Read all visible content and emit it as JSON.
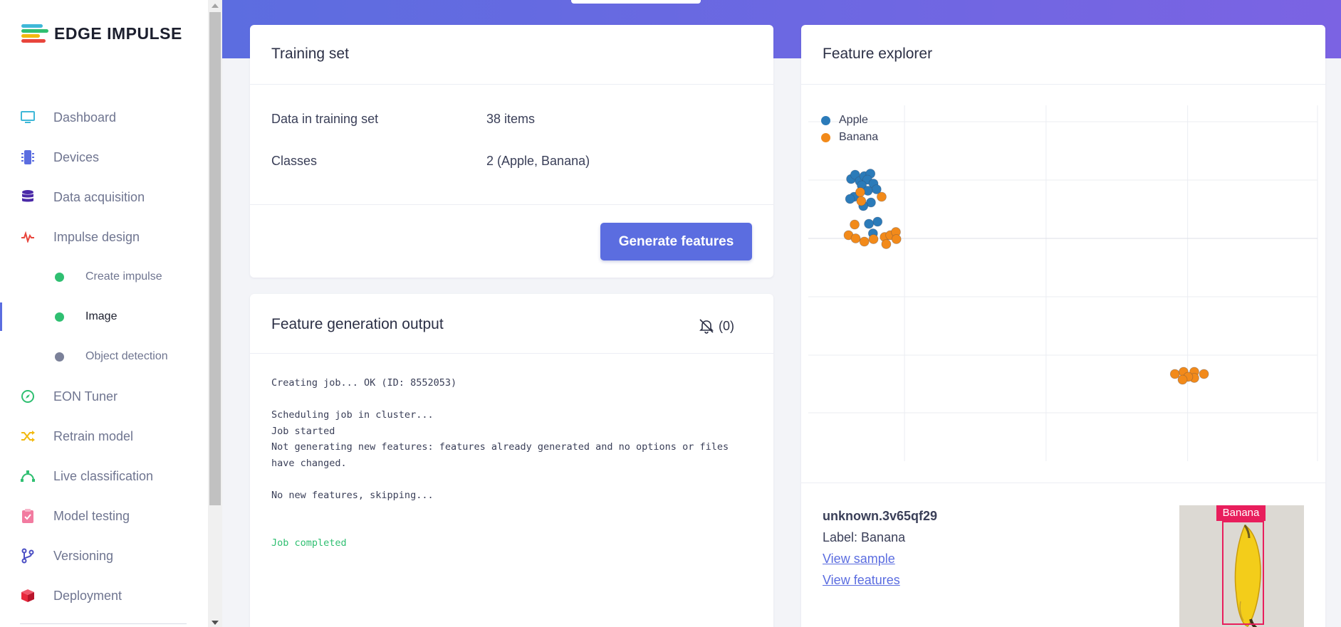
{
  "brand": {
    "name": "EDGE IMPULSE"
  },
  "nav": {
    "items": [
      {
        "label": "Dashboard",
        "icon": "monitor-icon",
        "color": "#3fb8d8"
      },
      {
        "label": "Devices",
        "icon": "chip-icon",
        "color": "#5b6de0"
      },
      {
        "label": "Data acquisition",
        "icon": "database-icon",
        "color": "#4b2aa8"
      },
      {
        "label": "Impulse design",
        "icon": "pulse-icon",
        "color": "#e8453c"
      }
    ],
    "sub_items": [
      {
        "label": "Create impulse",
        "dot_color": "#2fbf71"
      },
      {
        "label": "Image",
        "dot_color": "#2fbf71"
      },
      {
        "label": "Object detection",
        "dot_color": "#7b8199"
      }
    ],
    "bottom_items": [
      {
        "label": "EON Tuner",
        "icon": "compass-icon",
        "color": "#2fbf71"
      },
      {
        "label": "Retrain model",
        "icon": "shuffle-icon",
        "color": "#f2b90f"
      },
      {
        "label": "Live classification",
        "icon": "bezier-icon",
        "color": "#2fbf71"
      },
      {
        "label": "Model testing",
        "icon": "clipboard-check-icon",
        "color": "#f27ba0"
      },
      {
        "label": "Versioning",
        "icon": "branch-icon",
        "color": "#4b4fc4"
      },
      {
        "label": "Deployment",
        "icon": "cube-icon",
        "color": "#e8283c"
      }
    ]
  },
  "training_set": {
    "title": "Training set",
    "rows": [
      {
        "label": "Data in training set",
        "value": "38 items"
      },
      {
        "label": "Classes",
        "value": "2 (Apple, Banana)"
      }
    ],
    "button": "Generate features"
  },
  "feature_output": {
    "title": "Feature generation output",
    "notification_count": "(0)",
    "log": [
      "Creating job... OK (ID: 8552053)",
      "",
      "Scheduling job in cluster...",
      "Job started",
      "Not generating new features: features already generated and no options or files",
      "have changed.",
      "",
      "No new features, skipping...",
      "",
      ""
    ],
    "log_done": "Job completed"
  },
  "feature_explorer": {
    "title": "Feature explorer",
    "legend": [
      {
        "name": "Apple",
        "color": "#2b7bb9"
      },
      {
        "name": "Banana",
        "color": "#f28a1a"
      }
    ],
    "sample": {
      "id": "unknown.3v65qf29",
      "label": "Label: Banana",
      "view_sample": "View sample",
      "view_features": "View features",
      "bbox_label": "Banana"
    }
  },
  "chart_data": {
    "type": "scatter",
    "title": "",
    "xlabel": "",
    "ylabel": "",
    "grid": true,
    "legend": "top-left",
    "xlim": [
      0,
      100
    ],
    "ylim": [
      0,
      100
    ],
    "series": [
      {
        "name": "Apple",
        "color": "#2b7bb9",
        "x": [
          8.4,
          9.2,
          10.1,
          11.0,
          12.2,
          11.6,
          10.5,
          12.8,
          9.0,
          13.4,
          11.7,
          8.2,
          12.3,
          10.8,
          13.6,
          11.9,
          12.7
        ],
        "y": [
          79.3,
          80.5,
          78.7,
          80.1,
          80.8,
          79.1,
          77.5,
          78.0,
          74.3,
          76.4,
          76.0,
          73.7,
          72.7,
          71.7,
          67.3,
          66.7,
          64.0
        ]
      },
      {
        "name": "Banana",
        "color": "#f28a1a",
        "x": [
          10.2,
          14.4,
          10.4,
          9.1,
          7.9,
          9.3,
          11.0,
          12.8,
          15.0,
          16.1,
          17.2,
          15.3,
          17.3,
          72.0,
          73.7,
          75.8,
          77.7,
          75.8,
          74.6,
          73.5
        ],
        "y": [
          75.6,
          74.3,
          73.1,
          66.5,
          63.5,
          62.6,
          61.7,
          62.4,
          63.0,
          63.5,
          64.4,
          61.0,
          62.4,
          24.5,
          25.1,
          25.1,
          24.5,
          23.4,
          23.7,
          22.9
        ]
      }
    ]
  }
}
